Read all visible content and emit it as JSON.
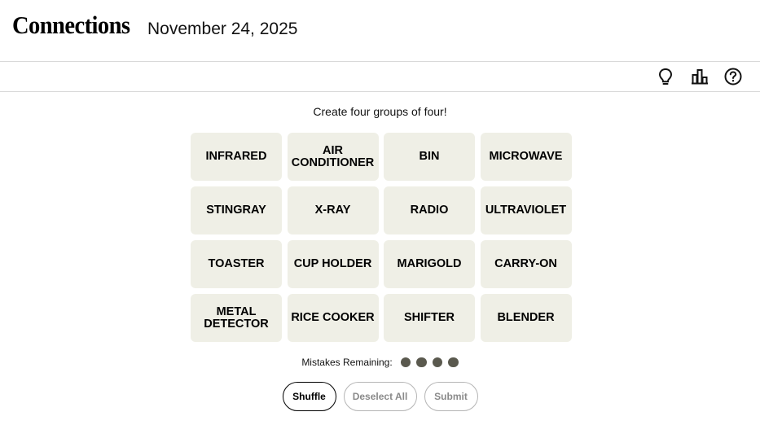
{
  "header": {
    "title": "Connections",
    "date": "November 24, 2025"
  },
  "toolbar": {
    "icons": [
      "lightbulb-icon",
      "leaderboard-icon",
      "help-icon"
    ]
  },
  "game": {
    "instructions": "Create four groups of four!",
    "tiles": [
      {
        "line1": "INFRARED",
        "line2": ""
      },
      {
        "line1": "AIR",
        "line2": "CONDITIONER"
      },
      {
        "line1": "BIN",
        "line2": ""
      },
      {
        "line1": "MICROWAVE",
        "line2": ""
      },
      {
        "line1": "STINGRAY",
        "line2": ""
      },
      {
        "line1": "X-RAY",
        "line2": ""
      },
      {
        "line1": "RADIO",
        "line2": ""
      },
      {
        "line1": "ULTRAVIOLET",
        "line2": ""
      },
      {
        "line1": "TOASTER",
        "line2": ""
      },
      {
        "line1": "CUP HOLDER",
        "line2": ""
      },
      {
        "line1": "MARIGOLD",
        "line2": ""
      },
      {
        "line1": "CARRY-ON",
        "line2": ""
      },
      {
        "line1": "METAL",
        "line2": "DETECTOR"
      },
      {
        "line1": "RICE COOKER",
        "line2": ""
      },
      {
        "line1": "SHIFTER",
        "line2": ""
      },
      {
        "line1": "BLENDER",
        "line2": ""
      }
    ],
    "mistakes_label": "Mistakes Remaining:",
    "mistakes_remaining": 4,
    "dot_color": "#5a594e",
    "tile_color": "#efefe6"
  },
  "buttons": {
    "shuffle": "Shuffle",
    "deselect_all": "Deselect All",
    "submit": "Submit"
  }
}
